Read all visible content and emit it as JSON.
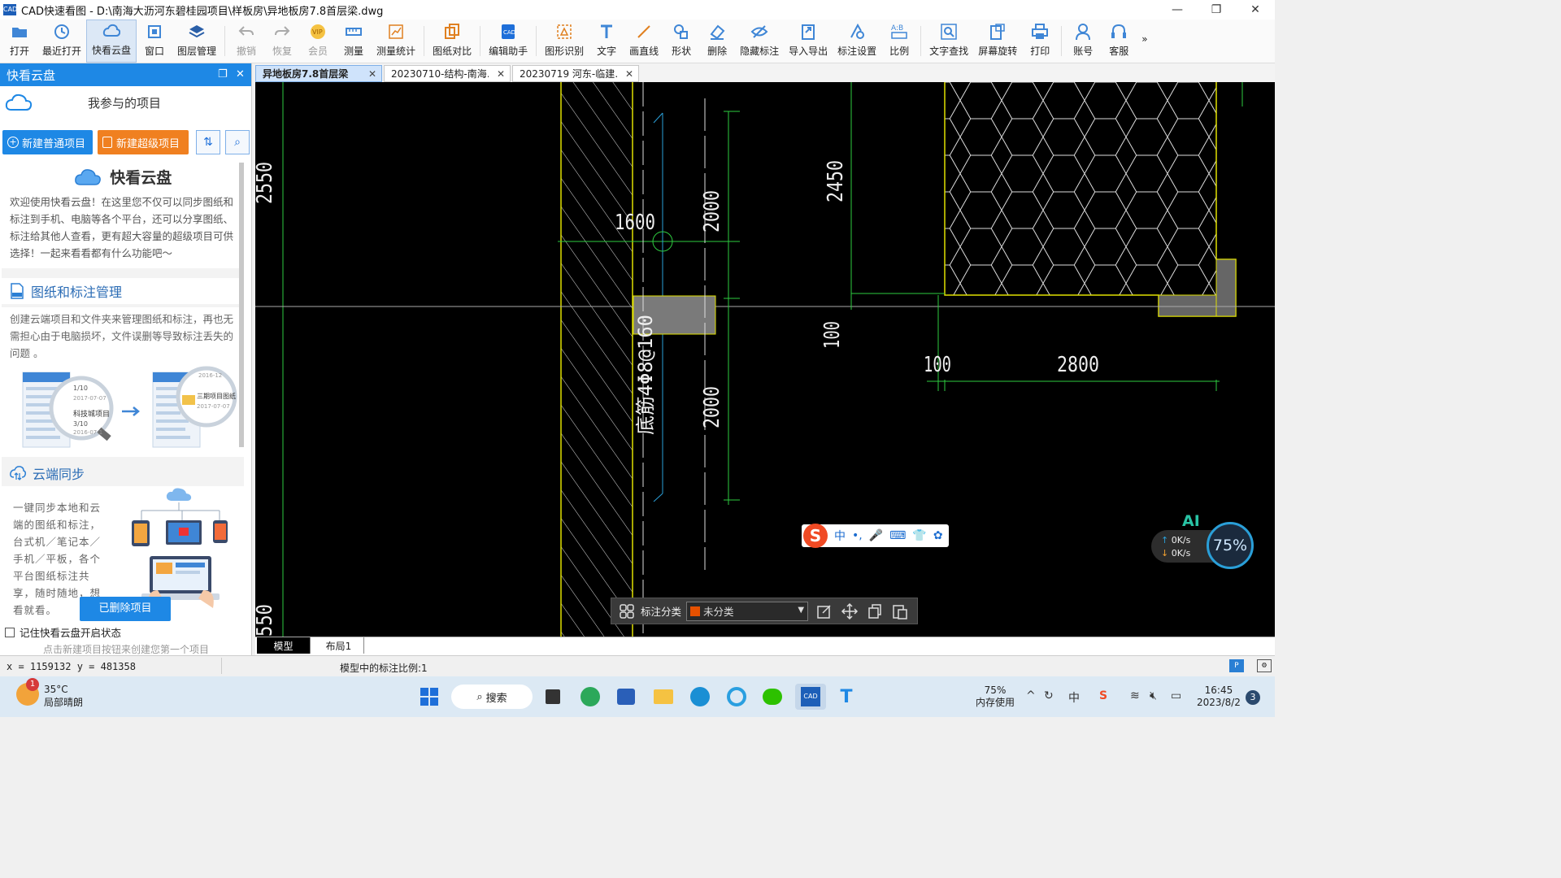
{
  "window": {
    "title": "CAD快速看图 - D:\\南海大沥河东碧桂园项目\\样板房\\异地板房7.8首层梁.dwg",
    "app_icon_text": "CAD"
  },
  "toolbar": {
    "items": [
      {
        "label": "打开",
        "icon": "open-folder-icon"
      },
      {
        "label": "最近打开",
        "icon": "history-icon"
      },
      {
        "label": "快看云盘",
        "icon": "cloud-icon",
        "active": true
      },
      {
        "label": "窗口",
        "icon": "window-icon"
      },
      {
        "label": "图层管理",
        "icon": "layers-icon"
      },
      {
        "label": "撤销",
        "icon": "undo-icon",
        "disabled": true
      },
      {
        "label": "恢复",
        "icon": "redo-icon",
        "disabled": true
      },
      {
        "label": "会员",
        "icon": "vip-icon",
        "disabled": true
      },
      {
        "label": "测量",
        "icon": "measure-icon"
      },
      {
        "label": "测量统计",
        "icon": "measure-stats-icon"
      },
      {
        "label": "图纸对比",
        "icon": "compare-icon"
      },
      {
        "label": "编辑助手",
        "icon": "edit-helper-icon"
      },
      {
        "label": "图形识别",
        "icon": "shape-recognize-icon"
      },
      {
        "label": "文字",
        "icon": "text-icon"
      },
      {
        "label": "画直线",
        "icon": "line-icon"
      },
      {
        "label": "形状",
        "icon": "shape-icon"
      },
      {
        "label": "删除",
        "icon": "eraser-icon"
      },
      {
        "label": "隐藏标注",
        "icon": "hide-icon"
      },
      {
        "label": "导入导出",
        "icon": "import-export-icon"
      },
      {
        "label": "标注设置",
        "icon": "annotation-settings-icon"
      },
      {
        "label": "比例",
        "icon": "scale-icon"
      },
      {
        "label": "文字查找",
        "icon": "text-search-icon"
      },
      {
        "label": "屏幕旋转",
        "icon": "rotate-screen-icon"
      },
      {
        "label": "打印",
        "icon": "print-icon"
      },
      {
        "label": "账号",
        "icon": "account-icon"
      },
      {
        "label": "客服",
        "icon": "support-icon"
      }
    ],
    "more": "»"
  },
  "panel": {
    "title": "快看云盘",
    "subtitle": "我参与的项目",
    "new_normal": "新建普通项目",
    "new_super": "新建超级项目",
    "intro_title": "快看云盘",
    "intro_text": "欢迎使用快看云盘！在这里您不仅可以同步图纸和标注到手机、电脑等各个平台，还可以分享图纸、标注给其他人查看，更有超大容量的超级项目可供选择！一起来看看都有什么功能吧～",
    "sec1_title": "图纸和标注管理",
    "sec1_text": "创建云端项目和文件夹来管理图纸和标注，再也无需担心由于电脑损坏，文件误删等导致标注丢失的问题 。",
    "sec1_img": {
      "a_line1": "2017-07-07",
      "a_title": "科技城项目",
      "a_count": "3/10",
      "a_date": "2016-07-1",
      "a_count_top": "1/10",
      "b_date_top": "2016-12",
      "b_title": "三期项目图纸",
      "b_date": "2017-07-07"
    },
    "sec2_title": "云端同步",
    "sec2_text": "一键同步本地和云端的图纸和标注，台式机／笔记本／手机／平板，各个平台图纸标注共享，随时随地，想看就看。",
    "deleted_btn": "已删除项目",
    "remember": "记住快看云盘开启状态",
    "hint": "点击新建项目按钮来创建您第一个项目"
  },
  "tabs": [
    {
      "label": "异地板房7.8首层梁",
      "active": true
    },
    {
      "label": "20230710-结构-南海…"
    },
    {
      "label": "20230719  河东-临建…"
    }
  ],
  "drawing": {
    "dims": [
      "1600",
      "2000",
      "2000",
      "2450",
      "100",
      "100",
      "2800",
      "2550",
      "550"
    ],
    "rebar_note": "底筋4Φ8@160"
  },
  "layout_tabs": [
    "模型",
    "布局1"
  ],
  "status": {
    "coords": "x = 1159132  y = 481358",
    "scale_text": "模型中的标注比例:1"
  },
  "annotation_bar": {
    "label": "标注分类",
    "selected": "未分类",
    "swatch_color": "#e65100"
  },
  "ime": {
    "items": [
      "中",
      "•,",
      "🎤",
      "⌨",
      "👕",
      "✿"
    ]
  },
  "speed_widget": {
    "ai": "AI",
    "up": "0K/s",
    "down": "0K/s",
    "percent": "75%"
  },
  "taskbar": {
    "weather_badge": "1",
    "temp": "35°C",
    "weather": "局部晴朗",
    "search": "搜索",
    "mem_pct": "75%",
    "mem_label": "内存使用",
    "time": "16:45",
    "date": "2023/8/2",
    "notifications": "3"
  }
}
